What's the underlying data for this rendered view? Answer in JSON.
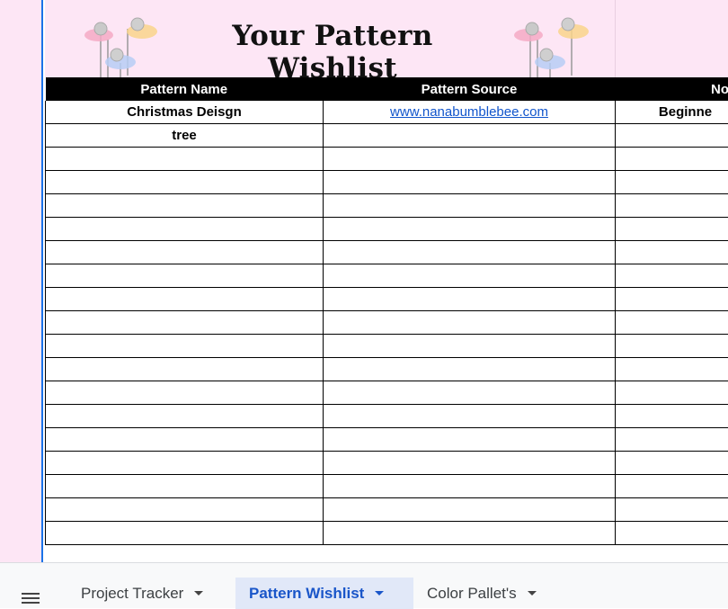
{
  "header": {
    "title": "Your Pattern Wishlist",
    "colors": {
      "background": "#fde6f5",
      "title": "#111111"
    }
  },
  "table": {
    "columns": [
      "Pattern Name",
      "Pattern Source",
      "No"
    ],
    "rows": [
      {
        "name": "Christmas Deisgn",
        "source": "www.nanabumblebee.com",
        "level": "Beginne"
      },
      {
        "name": "tree",
        "source": "",
        "level": ""
      },
      {
        "name": "",
        "source": "",
        "level": ""
      },
      {
        "name": "",
        "source": "",
        "level": ""
      },
      {
        "name": "",
        "source": "",
        "level": ""
      },
      {
        "name": "",
        "source": "",
        "level": ""
      },
      {
        "name": "",
        "source": "",
        "level": ""
      },
      {
        "name": "",
        "source": "",
        "level": ""
      },
      {
        "name": "",
        "source": "",
        "level": ""
      },
      {
        "name": "",
        "source": "",
        "level": ""
      },
      {
        "name": "",
        "source": "",
        "level": ""
      },
      {
        "name": "",
        "source": "",
        "level": ""
      },
      {
        "name": "",
        "source": "",
        "level": ""
      },
      {
        "name": "",
        "source": "",
        "level": ""
      },
      {
        "name": "",
        "source": "",
        "level": ""
      },
      {
        "name": "",
        "source": "",
        "level": ""
      },
      {
        "name": "",
        "source": "",
        "level": ""
      },
      {
        "name": "",
        "source": "",
        "level": ""
      },
      {
        "name": "",
        "source": "",
        "level": ""
      }
    ],
    "colors": {
      "header_bg": "#000000",
      "header_text": "#ffffff",
      "link": "#1155cc"
    }
  },
  "sheet_tabs": {
    "menu_icon": "hamburger-menu-icon",
    "tabs": [
      {
        "label": "Project Tracker",
        "active": false
      },
      {
        "label": "Pattern Wishlist",
        "active": true
      },
      {
        "label": "Color Pallet's",
        "active": false
      }
    ],
    "colors": {
      "active_bg": "#e1e8f8",
      "active_text": "#1a56c9"
    }
  }
}
